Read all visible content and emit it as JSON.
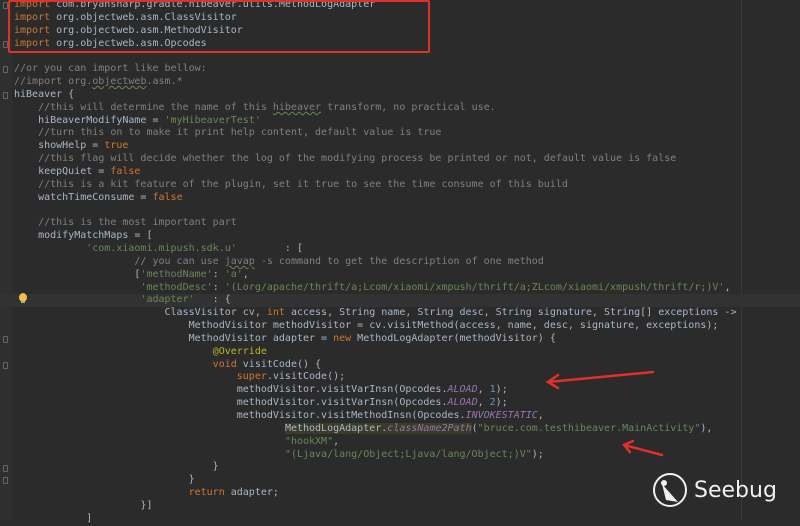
{
  "editor": {
    "colors": {
      "background": "#2b2b2b",
      "text": "#a9b7c6",
      "keyword": "#cc7832",
      "comment": "#808080",
      "string": "#6a8759",
      "number": "#6897bb",
      "constant": "#9876aa",
      "annotation": "#bbb529",
      "highlight_box": "#e0302a"
    },
    "lines": [
      [
        [
          "k",
          "import"
        ],
        [
          "t",
          " com.bryansharp.gradle.hibeaver.utils.MethodLogAdapter"
        ]
      ],
      [
        [
          "k",
          "import"
        ],
        [
          "t",
          " org.objectweb.asm.ClassVisitor"
        ]
      ],
      [
        [
          "k",
          "import"
        ],
        [
          "t",
          " org.objectweb.asm.MethodVisitor"
        ]
      ],
      [
        [
          "k",
          "import"
        ],
        [
          "t",
          " org.objectweb.asm.Opcodes"
        ]
      ],
      [],
      [
        [
          "c",
          "//or you can import like bellow:"
        ]
      ],
      [
        [
          "c",
          "//import org."
        ],
        [
          "cu",
          "objectweb"
        ],
        [
          "c",
          ".asm.*"
        ]
      ],
      [
        [
          "t",
          "hiBeaver {"
        ]
      ],
      [
        [
          "c",
          "    //this will determine the name of this "
        ],
        [
          "cu",
          "hibeaver"
        ],
        [
          "c",
          " transform, no practical use."
        ]
      ],
      [
        [
          "t",
          "    hiBeaverModifyName = "
        ],
        [
          "s",
          "'myHibeaverTest'"
        ]
      ],
      [
        [
          "c",
          "    //turn this on to make it print help content, default value is true"
        ]
      ],
      [
        [
          "t",
          "    showHelp = "
        ],
        [
          "k",
          "true"
        ]
      ],
      [
        [
          "c",
          "    //this flag will decide whether the log of the modifying process be printed or not, default value is false"
        ]
      ],
      [
        [
          "t",
          "    keepQuiet = "
        ],
        [
          "k",
          "false"
        ]
      ],
      [
        [
          "c",
          "    //this is a kit feature of the plugin, set it true to see the time consume of this build"
        ]
      ],
      [
        [
          "t",
          "    watchTimeConsume = "
        ],
        [
          "k",
          "false"
        ]
      ],
      [],
      [
        [
          "c",
          "    //this is the most important part"
        ]
      ],
      [
        [
          "t",
          "    modifyMatchMaps = ["
        ]
      ],
      [
        [
          "s",
          "            'com.xiaomi.mipush.sdk.u'"
        ],
        [
          "t",
          "        : ["
        ]
      ],
      [
        [
          "c",
          "                    // you can use "
        ],
        [
          "cu",
          "javap"
        ],
        [
          "c",
          " -s command to get the description of one method"
        ]
      ],
      [
        [
          "t",
          "                    ["
        ],
        [
          "s",
          "'methodName'"
        ],
        [
          "t",
          ": "
        ],
        [
          "s",
          "'a'"
        ],
        [
          "t",
          ","
        ]
      ],
      [
        [
          "s",
          "                     'methodDesc'"
        ],
        [
          "t",
          ": "
        ],
        [
          "s",
          "'(Lorg/apache/thrift/a;Lcom/xiaomi/xmpush/thrift/a;ZLcom/xiaomi/xmpush/thrift/r;)V'"
        ],
        [
          "t",
          ","
        ]
      ],
      [
        [
          "s",
          "                     'adapter'"
        ],
        [
          "t",
          "   : {"
        ]
      ],
      [
        [
          "t",
          "                         ClassVisitor cv, "
        ],
        [
          "k",
          "int"
        ],
        [
          "t",
          " access, String name, String desc, String signature, String[] exceptions ->"
        ]
      ],
      [
        [
          "t",
          "                             MethodVisitor methodVisitor = cv.visitMethod(access, name, desc, signature, exceptions);"
        ]
      ],
      [
        [
          "t",
          "                             MethodVisitor adapter = "
        ],
        [
          "k",
          "new"
        ],
        [
          "t",
          " MethodLogAdapter(methodVisitor) {"
        ]
      ],
      [
        [
          "a",
          "                                 @Override"
        ]
      ],
      [
        [
          "k",
          "                                 void"
        ],
        [
          "t",
          " visitCode() {"
        ]
      ],
      [
        [
          "k",
          "                                     super"
        ],
        [
          "t",
          ".visitCode();"
        ]
      ],
      [
        [
          "t",
          "                                     methodVisitor.visitVarInsn(Opcodes."
        ],
        [
          "i",
          "ALOAD"
        ],
        [
          "t",
          ", "
        ],
        [
          "n",
          "1"
        ],
        [
          "t",
          ");"
        ]
      ],
      [
        [
          "t",
          "                                     methodVisitor.visitVarInsn(Opcodes."
        ],
        [
          "i",
          "ALOAD"
        ],
        [
          "t",
          ", "
        ],
        [
          "n",
          "2"
        ],
        [
          "t",
          ");"
        ]
      ],
      [
        [
          "t",
          "                                     methodVisitor.visitMethodInsn(Opcodes."
        ],
        [
          "i",
          "INVOKESTATIC"
        ],
        [
          "t",
          ","
        ]
      ],
      [
        [
          "t",
          "                                             "
        ],
        [
          "h",
          "MethodLogAdapter."
        ],
        [
          "f",
          "className2Path"
        ],
        [
          "t",
          "("
        ],
        [
          "s",
          "\"bruce.com.testhibeaver.MainActivity\""
        ],
        [
          "t",
          "),"
        ]
      ],
      [
        [
          "s",
          "                                             \"hookXM\""
        ],
        [
          "t",
          ","
        ]
      ],
      [
        [
          "s",
          "                                             \"(Ljava/lang/Object;Ljava/lang/Object;)V\""
        ],
        [
          "t",
          ");"
        ]
      ],
      [
        [
          "t",
          "                                 }"
        ]
      ],
      [
        [
          "t",
          "                             }"
        ]
      ],
      [
        [
          "k",
          "                             return"
        ],
        [
          "t",
          " adapter;"
        ]
      ],
      [
        [
          "t",
          "                     }]"
        ]
      ],
      [
        [
          "t",
          "            ]"
        ]
      ]
    ],
    "current_line": 23
  },
  "watermark": {
    "text": "Seebug"
  }
}
